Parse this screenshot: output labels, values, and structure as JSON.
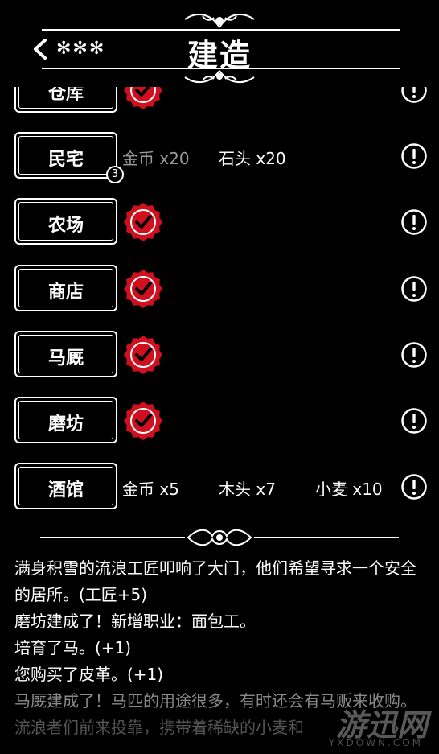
{
  "header": {
    "title": "建造",
    "stars": "✻✻✻"
  },
  "buildings": [
    {
      "name": "仓库",
      "built": true,
      "costs": []
    },
    {
      "name": "民宅",
      "built": false,
      "badge": "3",
      "costs": [
        "金币 x20",
        "石头 x20"
      ]
    },
    {
      "name": "农场",
      "built": true,
      "costs": []
    },
    {
      "name": "商店",
      "built": true,
      "costs": []
    },
    {
      "name": "马厩",
      "built": true,
      "costs": []
    },
    {
      "name": "磨坊",
      "built": true,
      "costs": []
    },
    {
      "name": "酒馆",
      "built": false,
      "costs": [
        "金币 x5",
        "木头 x7",
        "小麦 x10"
      ]
    }
  ],
  "log": [
    "满身积雪的流浪工匠叩响了大门，他们希望寻求一个安全的居所。(工匠+5)",
    "磨坊建成了！新增职业：面包工。",
    "培育了马。(+1)",
    "您购买了皮革。(+1)",
    "马厩建成了！马匹的用途很多，有时还会有马贩来收购。",
    "流浪者们前来投靠，携带着稀缺的小麦和"
  ],
  "watermark": {
    "text": "游迅网",
    "sub": "YXDOWN.COM"
  },
  "colors": {
    "background": "#000000",
    "check_red": "#d0101e",
    "text": "#ffffff"
  }
}
